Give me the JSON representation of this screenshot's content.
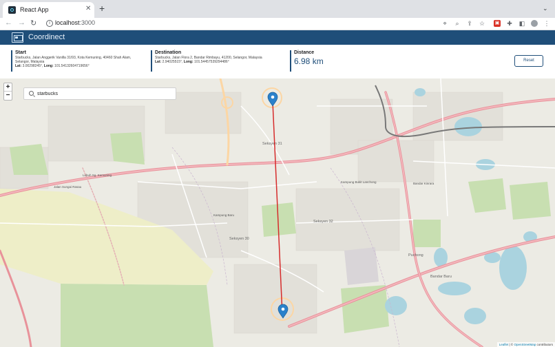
{
  "browser": {
    "tab_title": "React App",
    "tab_close": "✕",
    "new_tab": "+",
    "chevron": "⌄",
    "url_host": "localhost",
    "url_port": ":3000",
    "nav_back": "←",
    "nav_forward": "→",
    "nav_reload": "↻"
  },
  "app": {
    "title": "Coordinect"
  },
  "start": {
    "label": "Start",
    "address": "Starbucks, Jalan Anggerik Vanilla 31/93, Kota Kemuning, 40460 Shah Alam, Selangor, Malaysia",
    "lat_label": "Lat:",
    "lat": "3.00298245°",
    "lng_label": "Long:",
    "lng": "101.54132604719656°"
  },
  "destination": {
    "label": "Destination",
    "address": "Starbucks, Jalan Flora 2, Bandar Rimbayu, 41200, Selangor, Malaysia",
    "lat_label": "Lat:",
    "lat": "2.94025515°",
    "lng_label": "Long:",
    "lng": "101.54457539294486°"
  },
  "distance": {
    "label": "Distance",
    "value": "6.98",
    "unit": "km"
  },
  "reset_button": "Reset",
  "map": {
    "zoom_in": "+",
    "zoom_out": "−",
    "search_value": "starbucks",
    "search_placeholder": "Search",
    "attribution_leaflet": "Leaflet",
    "attribution_sep": " | © ",
    "attribution_osm": "OpenStreetMap",
    "attribution_tail": " contributors",
    "route_color": "#d62b2b",
    "marker_color": "#2a81cb",
    "labels": {
      "seksyen31": "Seksyen 31",
      "seksyen30": "Seksyen 30",
      "seksyen32": "Seksyen 32",
      "kampung_baru": "Kampung Baru",
      "bandar_baru": "Bandar Baru",
      "jalan_sungai": "Jalan Sungai Rasau",
      "kampung_bukit": "Kampung Bukit Lanchong",
      "lebuh_sg": "Lebuh Sg. Kemuning",
      "puchong": "Puchong",
      "bandar_kinrara": "Bandar Kinrara"
    }
  }
}
